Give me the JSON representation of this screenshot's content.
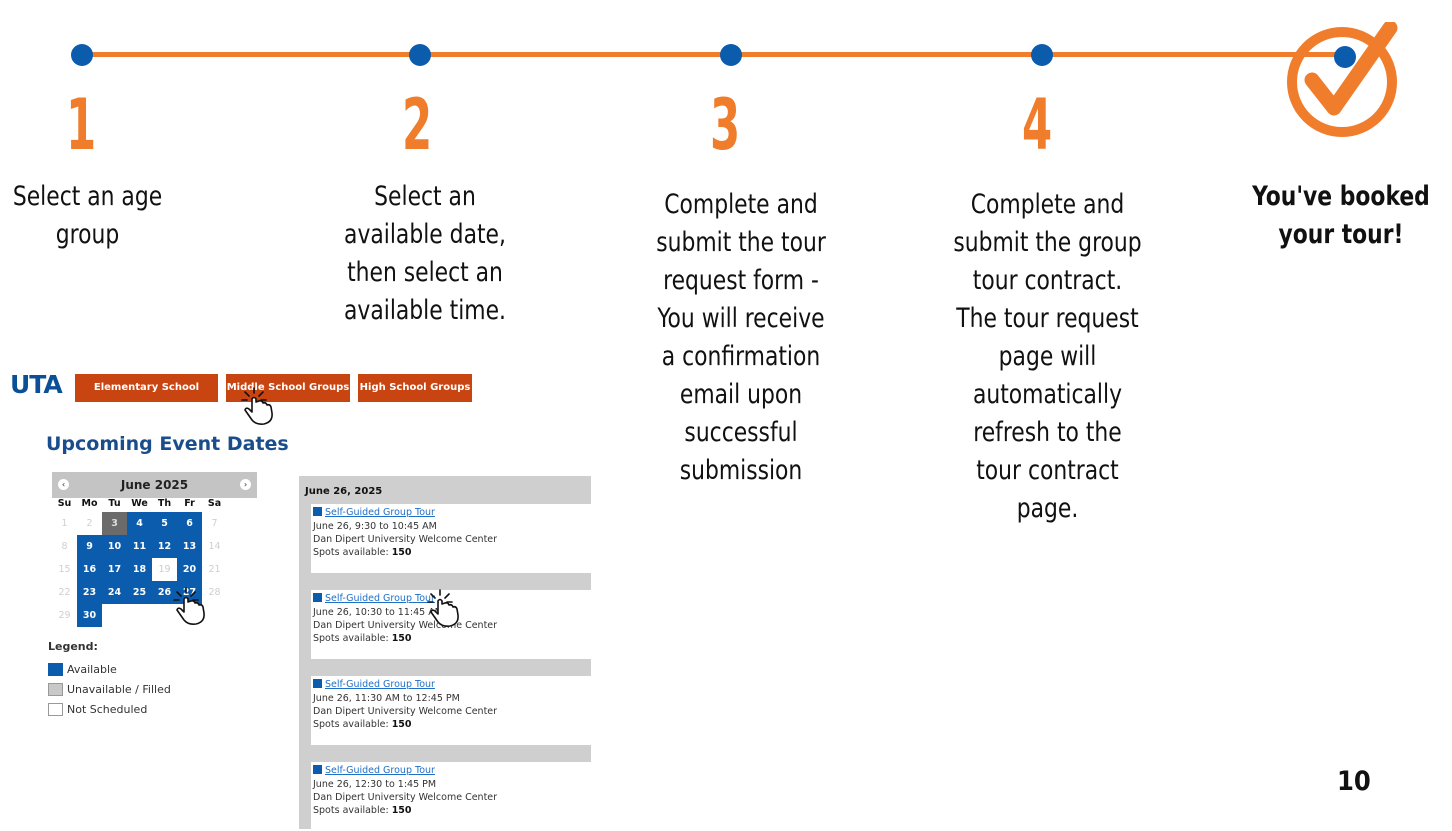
{
  "steps": [
    {
      "num": "1",
      "lines": [
        "Select an age",
        "group"
      ]
    },
    {
      "num": "2",
      "lines": [
        "Select an",
        "available date,",
        "then select an",
        "available time."
      ]
    },
    {
      "num": "3",
      "lines": [
        "Complete and",
        "submit the tour",
        "request form -",
        "You will receive",
        "a confirmation",
        "email upon",
        "successful",
        "submission"
      ]
    },
    {
      "num": "4",
      "lines": [
        "Complete and",
        "submit the group",
        "tour contract.",
        "The tour request",
        "page will",
        "automatically",
        "refresh to the",
        "tour contract",
        "page."
      ]
    }
  ],
  "done": {
    "lines": [
      "You've booked",
      "your tour!"
    ]
  },
  "page_number": "10",
  "colors": {
    "accent": "#ef7d2b",
    "dot": "#0b5cad",
    "tab": "#c84512"
  },
  "site": {
    "logo": "UTA",
    "tabs": [
      "Elementary School Groups",
      "Middle School Groups",
      "High School Groups"
    ],
    "heading": "Upcoming Event Dates"
  },
  "calendar": {
    "month": "June 2025",
    "dow": [
      "Su",
      "Mo",
      "Tu",
      "We",
      "Th",
      "Fr",
      "Sa"
    ],
    "weeks": [
      [
        [
          "1",
          "off"
        ],
        [
          "2",
          "off"
        ],
        [
          "3",
          "un"
        ],
        [
          "4",
          "av"
        ],
        [
          "5",
          "av"
        ],
        [
          "6",
          "av"
        ],
        [
          "7",
          "off"
        ]
      ],
      [
        [
          "8",
          "off"
        ],
        [
          "9",
          "av"
        ],
        [
          "10",
          "av"
        ],
        [
          "11",
          "av"
        ],
        [
          "12",
          "av"
        ],
        [
          "13",
          "av"
        ],
        [
          "14",
          "off"
        ]
      ],
      [
        [
          "15",
          "off"
        ],
        [
          "16",
          "av"
        ],
        [
          "17",
          "av"
        ],
        [
          "18",
          "av"
        ],
        [
          "19",
          "ns"
        ],
        [
          "20",
          "av"
        ],
        [
          "21",
          "off"
        ]
      ],
      [
        [
          "22",
          "off"
        ],
        [
          "23",
          "av"
        ],
        [
          "24",
          "av"
        ],
        [
          "25",
          "av"
        ],
        [
          "26",
          "av"
        ],
        [
          "27",
          "av"
        ],
        [
          "28",
          "off"
        ]
      ],
      [
        [
          "29",
          "off"
        ],
        [
          "30",
          "av"
        ],
        [
          "",
          ""
        ],
        [
          "",
          ""
        ],
        [
          "",
          ""
        ],
        [
          "",
          ""
        ],
        [
          "",
          ""
        ]
      ]
    ]
  },
  "legend": {
    "title": "Legend:",
    "items": [
      "Available",
      "Unavailable / Filled",
      "Not Scheduled"
    ]
  },
  "events": {
    "date": "June 26, 2025",
    "items": [
      {
        "title": "Self-Guided Group Tour",
        "time": "June 26, 9:30 to 10:45 AM",
        "place": "Dan Dipert University Welcome Center",
        "spots_label": "Spots available:",
        "spots": "150"
      },
      {
        "title": "Self-Guided Group Tour",
        "time": "June 26, 10:30 to 11:45 AM",
        "place": "Dan Dipert University Welcome Center",
        "spots_label": "Spots available:",
        "spots": "150"
      },
      {
        "title": "Self-Guided Group Tour",
        "time": "June 26, 11:30 AM to 12:45 PM",
        "place": "Dan Dipert University Welcome Center",
        "spots_label": "Spots available:",
        "spots": "150"
      },
      {
        "title": "Self-Guided Group Tour",
        "time": "June 26, 12:30 to 1:45 PM",
        "place": "Dan Dipert University Welcome Center",
        "spots_label": "Spots available:",
        "spots": "150"
      }
    ]
  }
}
